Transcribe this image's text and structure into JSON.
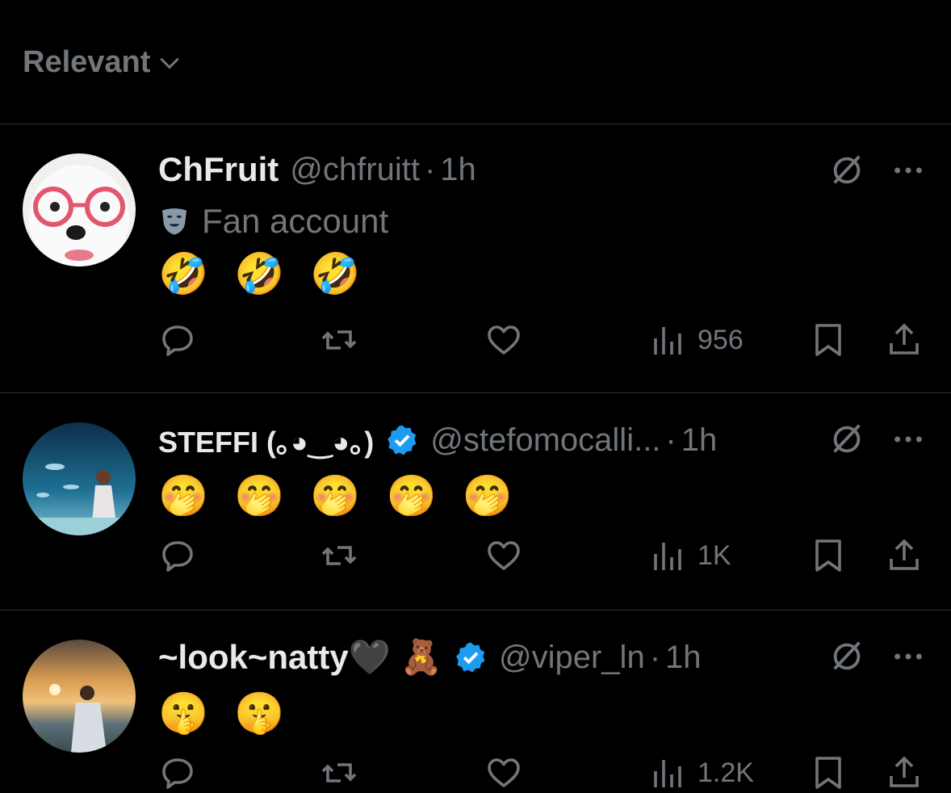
{
  "sort": {
    "label": "Relevant"
  },
  "posts": [
    {
      "display_name": "ChFruit",
      "handle": "@chfruitt",
      "separator": "·",
      "time": "1h",
      "label": "Fan account",
      "emoji": "🤣 🤣 🤣",
      "views": "956",
      "verified": false
    },
    {
      "display_name": "STEFFI (｡◕‿◕｡)",
      "handle": "@stefomocalli...",
      "separator": "·",
      "time": "1h",
      "emoji": "🤭 🤭 🤭 🤭 🤭",
      "views": "1K",
      "verified": true
    },
    {
      "display_name": "~look~natty🖤 🧸",
      "handle": "@viper_ln",
      "separator": "·",
      "time": "1h",
      "emoji": "🤫 🤫",
      "views": "1.2K",
      "verified": true
    }
  ],
  "colors": {
    "background": "#000000",
    "text_primary": "#e7e9ea",
    "text_secondary": "#71767b",
    "divider": "#2f3336",
    "verified_blue": "#1d9bf0"
  }
}
